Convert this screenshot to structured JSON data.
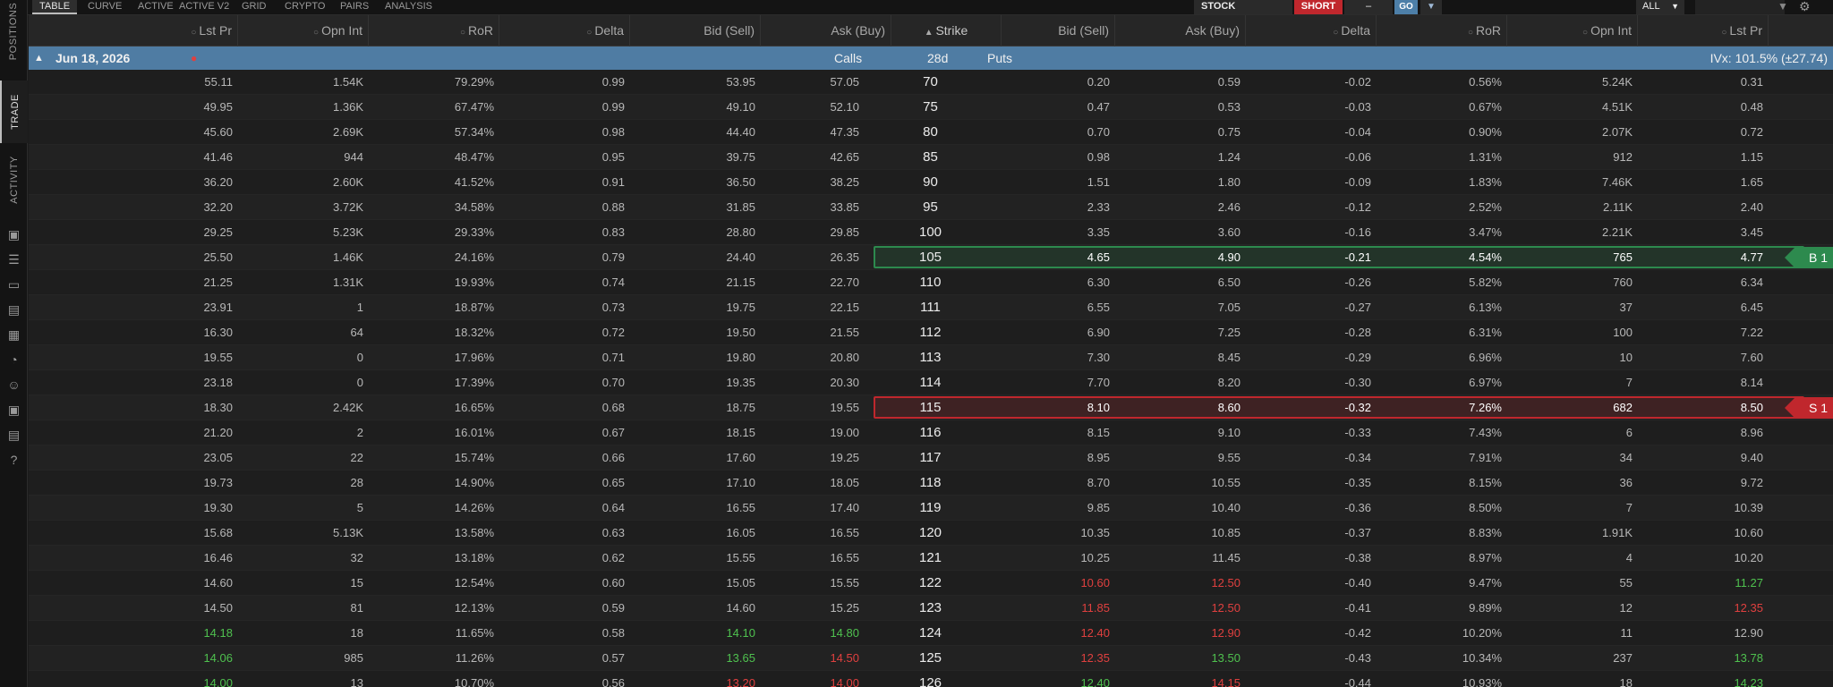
{
  "top_tabs": [
    "TABLE",
    "CURVE",
    "ACTIVE",
    "ACTIVE V2",
    "GRID",
    "CRYPTO",
    "PAIRS",
    "ANALYSIS"
  ],
  "order": {
    "stock_label": "STOCK",
    "short_label": "SHORT",
    "qty_label": "–",
    "go_label": "GO"
  },
  "filter": {
    "all_label": "ALL"
  },
  "side_tabs": [
    "POSITIONS",
    "TRADE",
    "ACTIVITY"
  ],
  "headers": {
    "calls": [
      "Lst Pr",
      "Opn Int",
      "RoR",
      "Delta",
      "Bid (Sell)",
      "Ask (Buy)"
    ],
    "strike": "Strike",
    "puts": [
      "Bid (Sell)",
      "Ask (Buy)",
      "Delta",
      "RoR",
      "Opn Int",
      "Lst Pr"
    ]
  },
  "expiration": {
    "date": "Jun 18, 2026",
    "calls_label": "Calls",
    "dte": "28d",
    "puts_label": "Puts",
    "ivx": "IVx: 101.5% (±27.74)"
  },
  "colors": {
    "green": "#4fc14f",
    "red": "#e0403f",
    "buy": "#2d8a4e",
    "sell": "#c0272d",
    "accent": "#4f7ca3"
  },
  "positions": [
    {
      "strike": "105",
      "label": "B 1",
      "side": "buy"
    },
    {
      "strike": "115",
      "label": "S 1",
      "side": "sell"
    }
  ],
  "rows": [
    {
      "strike": "70",
      "c": [
        "55.11",
        "1.54K",
        "79.29%",
        "0.99",
        "53.95",
        "57.05"
      ],
      "p": [
        "0.20",
        "0.59",
        "-0.02",
        "0.56%",
        "5.24K",
        "0.31"
      ]
    },
    {
      "strike": "75",
      "c": [
        "49.95",
        "1.36K",
        "67.47%",
        "0.99",
        "49.10",
        "52.10"
      ],
      "p": [
        "0.47",
        "0.53",
        "-0.03",
        "0.67%",
        "4.51K",
        "0.48"
      ]
    },
    {
      "strike": "80",
      "c": [
        "45.60",
        "2.69K",
        "57.34%",
        "0.98",
        "44.40",
        "47.35"
      ],
      "p": [
        "0.70",
        "0.75",
        "-0.04",
        "0.90%",
        "2.07K",
        "0.72"
      ]
    },
    {
      "strike": "85",
      "c": [
        "41.46",
        "944",
        "48.47%",
        "0.95",
        "39.75",
        "42.65"
      ],
      "p": [
        "0.98",
        "1.24",
        "-0.06",
        "1.31%",
        "912",
        "1.15"
      ]
    },
    {
      "strike": "90",
      "c": [
        "36.20",
        "2.60K",
        "41.52%",
        "0.91",
        "36.50",
        "38.25"
      ],
      "p": [
        "1.51",
        "1.80",
        "-0.09",
        "1.83%",
        "7.46K",
        "1.65"
      ]
    },
    {
      "strike": "95",
      "c": [
        "32.20",
        "3.72K",
        "34.58%",
        "0.88",
        "31.85",
        "33.85"
      ],
      "p": [
        "2.33",
        "2.46",
        "-0.12",
        "2.52%",
        "2.11K",
        "2.40"
      ]
    },
    {
      "strike": "100",
      "c": [
        "29.25",
        "5.23K",
        "29.33%",
        "0.83",
        "28.80",
        "29.85"
      ],
      "p": [
        "3.35",
        "3.60",
        "-0.16",
        "3.47%",
        "2.21K",
        "3.45"
      ]
    },
    {
      "strike": "105",
      "c": [
        "25.50",
        "1.46K",
        "24.16%",
        "0.79",
        "24.40",
        "26.35"
      ],
      "p": [
        "4.65",
        "4.90",
        "-0.21",
        "4.54%",
        "765",
        "4.77"
      ]
    },
    {
      "strike": "110",
      "c": [
        "21.25",
        "1.31K",
        "19.93%",
        "0.74",
        "21.15",
        "22.70"
      ],
      "p": [
        "6.30",
        "6.50",
        "-0.26",
        "5.82%",
        "760",
        "6.34"
      ]
    },
    {
      "strike": "111",
      "c": [
        "23.91",
        "1",
        "18.87%",
        "0.73",
        "19.75",
        "22.15"
      ],
      "p": [
        "6.55",
        "7.05",
        "-0.27",
        "6.13%",
        "37",
        "6.45"
      ]
    },
    {
      "strike": "112",
      "c": [
        "16.30",
        "64",
        "18.32%",
        "0.72",
        "19.50",
        "21.55"
      ],
      "p": [
        "6.90",
        "7.25",
        "-0.28",
        "6.31%",
        "100",
        "7.22"
      ]
    },
    {
      "strike": "113",
      "c": [
        "19.55",
        "0",
        "17.96%",
        "0.71",
        "19.80",
        "20.80"
      ],
      "p": [
        "7.30",
        "8.45",
        "-0.29",
        "6.96%",
        "10",
        "7.60"
      ]
    },
    {
      "strike": "114",
      "c": [
        "23.18",
        "0",
        "17.39%",
        "0.70",
        "19.35",
        "20.30"
      ],
      "p": [
        "7.70",
        "8.20",
        "-0.30",
        "6.97%",
        "7",
        "8.14"
      ]
    },
    {
      "strike": "115",
      "c": [
        "18.30",
        "2.42K",
        "16.65%",
        "0.68",
        "18.75",
        "19.55"
      ],
      "p": [
        "8.10",
        "8.60",
        "-0.32",
        "7.26%",
        "682",
        "8.50"
      ]
    },
    {
      "strike": "116",
      "c": [
        "21.20",
        "2",
        "16.01%",
        "0.67",
        "18.15",
        "19.00"
      ],
      "p": [
        "8.15",
        "9.10",
        "-0.33",
        "7.43%",
        "6",
        "8.96"
      ]
    },
    {
      "strike": "117",
      "c": [
        "23.05",
        "22",
        "15.74%",
        "0.66",
        "17.60",
        "19.25"
      ],
      "p": [
        "8.95",
        "9.55",
        "-0.34",
        "7.91%",
        "34",
        "9.40"
      ]
    },
    {
      "strike": "118",
      "c": [
        "19.73",
        "28",
        "14.90%",
        "0.65",
        "17.10",
        "18.05"
      ],
      "p": [
        "8.70",
        "10.55",
        "-0.35",
        "8.15%",
        "36",
        "9.72"
      ]
    },
    {
      "strike": "119",
      "c": [
        "19.30",
        "5",
        "14.26%",
        "0.64",
        "16.55",
        "17.40"
      ],
      "p": [
        "9.85",
        "10.40",
        "-0.36",
        "8.50%",
        "7",
        "10.39"
      ]
    },
    {
      "strike": "120",
      "c": [
        "15.68",
        "5.13K",
        "13.58%",
        "0.63",
        "16.05",
        "16.55"
      ],
      "p": [
        "10.35",
        "10.85",
        "-0.37",
        "8.83%",
        "1.91K",
        "10.60"
      ]
    },
    {
      "strike": "121",
      "c": [
        "16.46",
        "32",
        "13.18%",
        "0.62",
        "15.55",
        "16.55"
      ],
      "p": [
        "10.25",
        "11.45",
        "-0.38",
        "8.97%",
        "4",
        "10.20"
      ]
    },
    {
      "strike": "122",
      "c": [
        "14.60",
        "15",
        "12.54%",
        "0.60",
        "15.05",
        "15.55"
      ],
      "p": [
        "10.60",
        "12.50",
        "-0.40",
        "9.47%",
        "55",
        "11.27"
      ]
    },
    {
      "strike": "123",
      "c": [
        "14.50",
        "81",
        "12.13%",
        "0.59",
        "14.60",
        "15.25"
      ],
      "p": [
        "11.85",
        "12.50",
        "-0.41",
        "9.89%",
        "12",
        "12.35"
      ]
    },
    {
      "strike": "124",
      "c": [
        "14.18",
        "18",
        "11.65%",
        "0.58",
        "14.10",
        "14.80"
      ],
      "p": [
        "12.40",
        "12.90",
        "-0.42",
        "10.20%",
        "11",
        "12.90"
      ]
    },
    {
      "strike": "125",
      "c": [
        "14.06",
        "985",
        "11.26%",
        "0.57",
        "13.65",
        "14.50"
      ],
      "p": [
        "12.35",
        "13.50",
        "-0.43",
        "10.34%",
        "237",
        "13.78"
      ]
    },
    {
      "strike": "126",
      "c": [
        "14.00",
        "13",
        "10.70%",
        "0.56",
        "13.20",
        "14.00"
      ],
      "p": [
        "12.40",
        "14.15",
        "-0.44",
        "10.93%",
        "18",
        "14.23"
      ]
    }
  ],
  "color_rules": {
    "124": {
      "c": {
        "0": "green",
        "4": "green",
        "5": "green"
      },
      "p": {
        "0": "red",
        "1": "red"
      }
    },
    "125": {
      "c": {
        "0": "green",
        "4": "green",
        "5": "red"
      },
      "p": {
        "0": "red",
        "1": "green",
        "5": "green"
      }
    },
    "126": {
      "c": {
        "0": "green",
        "4": "red",
        "5": "red"
      },
      "p": {
        "0": "green",
        "1": "red",
        "5": "green"
      }
    },
    "122": {
      "p": {
        "0": "red",
        "1": "red",
        "5": "green"
      }
    },
    "123": {
      "p": {
        "0": "red",
        "1": "red",
        "5": "red"
      }
    }
  }
}
